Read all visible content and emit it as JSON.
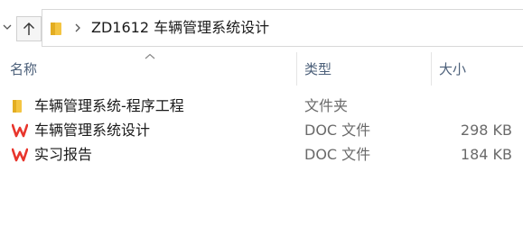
{
  "address": {
    "path": "ZD1612  车辆管理系统设计"
  },
  "columns": {
    "name": "名称",
    "type": "类型",
    "size": "大小"
  },
  "files": [
    {
      "name": "车辆管理系统-程序工程",
      "type": "文件夹",
      "size": "",
      "icon": "folder-icon"
    },
    {
      "name": "车辆管理系统设计",
      "type": "DOC 文件",
      "size": "298 KB",
      "icon": "wps-doc-icon"
    },
    {
      "name": "实习报告",
      "type": "DOC 文件",
      "size": "184 KB",
      "icon": "wps-doc-icon"
    }
  ],
  "colors": {
    "folder": "#f4c542",
    "wps": "#e8352c",
    "header_text": "#4c607a"
  }
}
